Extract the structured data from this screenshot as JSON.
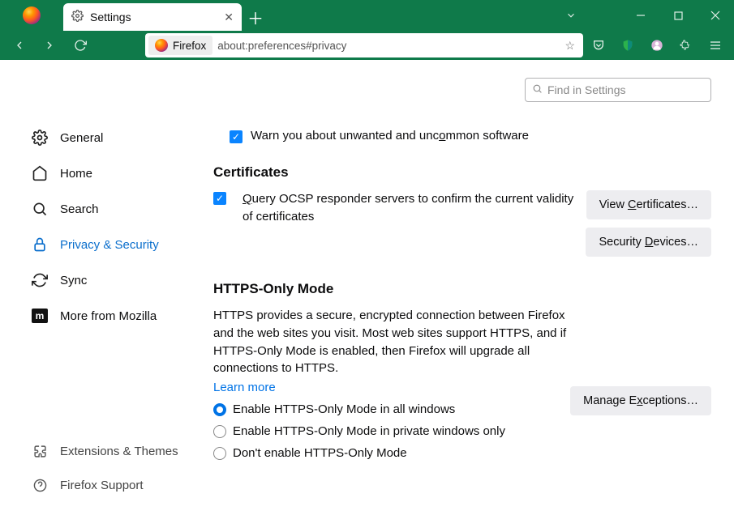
{
  "window": {
    "tab_title": "Settings"
  },
  "urlbar": {
    "identity": "Firefox",
    "url": "about:preferences#privacy"
  },
  "search_settings": {
    "placeholder": "Find in Settings"
  },
  "sidebar": {
    "items": [
      {
        "label": "General"
      },
      {
        "label": "Home"
      },
      {
        "label": "Search"
      },
      {
        "label": "Privacy & Security"
      },
      {
        "label": "Sync"
      },
      {
        "label": "More from Mozilla"
      }
    ],
    "bottom": {
      "extensions": "Extensions & Themes",
      "support": "Firefox Support"
    }
  },
  "main": {
    "warn_row": "Warn you about unwanted and uncommon software",
    "certificates": {
      "heading": "Certificates",
      "ocsp_prefix": "Q",
      "ocsp_text": "uery OCSP responder servers to confirm the current validity of certificates",
      "view_btn": "View Certificates…",
      "devices_btn": "Security Devices…"
    },
    "https": {
      "heading": "HTTPS-Only Mode",
      "desc": "HTTPS provides a secure, encrypted connection between Firefox and the web sites you visit. Most web sites support HTTPS, and if HTTPS-Only Mode is enabled, then Firefox will upgrade all connections to HTTPS.",
      "learn": "Learn more",
      "opt1": "Enable HTTPS-Only Mode in all windows",
      "opt2": "Enable HTTPS-Only Mode in private windows only",
      "opt3": "Don't enable HTTPS-Only Mode",
      "manage_btn": "Manage Exceptions…"
    }
  }
}
